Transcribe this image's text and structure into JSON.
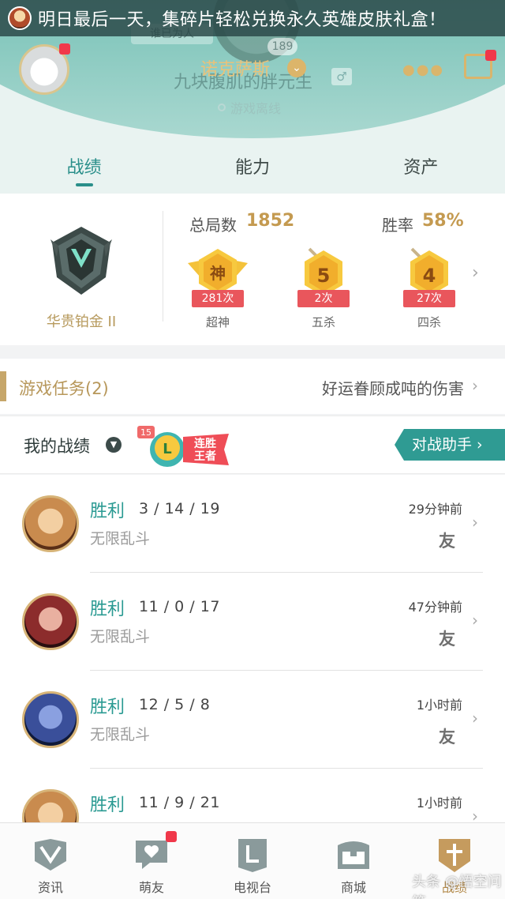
{
  "notice": {
    "text": "明日最后一天，集碎片轻松兑换永久英雄皮肤礼盒！"
  },
  "profile": {
    "team_tag": "谁已为人",
    "level": "189",
    "hero_name": "诺克萨斯",
    "nickname": "九块腹肌的胖元生",
    "status": "游戏离线"
  },
  "tabs": [
    {
      "label": "战绩",
      "active": true
    },
    {
      "label": "能力",
      "active": false
    },
    {
      "label": "资产",
      "active": false
    }
  ],
  "rank": {
    "tier": "华贵铂金 II",
    "total_games_label": "总局数",
    "total_games": "1852",
    "win_rate_label": "胜率",
    "win_rate": "58%",
    "medals": [
      {
        "glyph": "神",
        "count": "281次",
        "label": "超神"
      },
      {
        "glyph": "5",
        "count": "2次",
        "label": "五杀"
      },
      {
        "glyph": "4",
        "count": "27次",
        "label": "四杀"
      }
    ]
  },
  "tasks": {
    "title": "游戏任务(2)",
    "detail": "好运眷顾成吨的伤害"
  },
  "records": {
    "title": "我的战绩",
    "streak_badge": {
      "number": "15",
      "letter": "L",
      "line1": "连胜",
      "line2": "王者"
    },
    "assistant_button": "对战助手 ›"
  },
  "matches": [
    {
      "result": "胜利",
      "kda": "3 / 14 / 19",
      "mode": "无限乱斗",
      "time": "29分钟前",
      "tag": "友",
      "champ_color": "#c98b4e"
    },
    {
      "result": "胜利",
      "kda": "11 / 0 / 17",
      "mode": "无限乱斗",
      "time": "47分钟前",
      "tag": "友",
      "champ_color": "#8c2c2c"
    },
    {
      "result": "胜利",
      "kda": "12 / 5 / 8",
      "mode": "无限乱斗",
      "time": "1小时前",
      "tag": "友",
      "champ_color": "#3a4f9a"
    },
    {
      "result": "胜利",
      "kda": "11 / 9 / 21",
      "mode": "",
      "time": "1小时前",
      "tag": "",
      "champ_color": "#c98b4e"
    }
  ],
  "nav": [
    {
      "label": "资讯",
      "icon": "book-shield-icon",
      "active": false
    },
    {
      "label": "萌友",
      "icon": "chat-heart-icon",
      "active": false,
      "badge": true
    },
    {
      "label": "电视台",
      "icon": "tv-logo-icon",
      "active": false
    },
    {
      "label": "商城",
      "icon": "chest-icon",
      "active": false
    },
    {
      "label": "战绩",
      "icon": "sword-shield-icon",
      "active": true
    }
  ],
  "watermark": "头条 @悟空问答",
  "colors": {
    "accent": "#2a9a92",
    "gold": "#c49a50",
    "badge_red": "#e9565c"
  }
}
